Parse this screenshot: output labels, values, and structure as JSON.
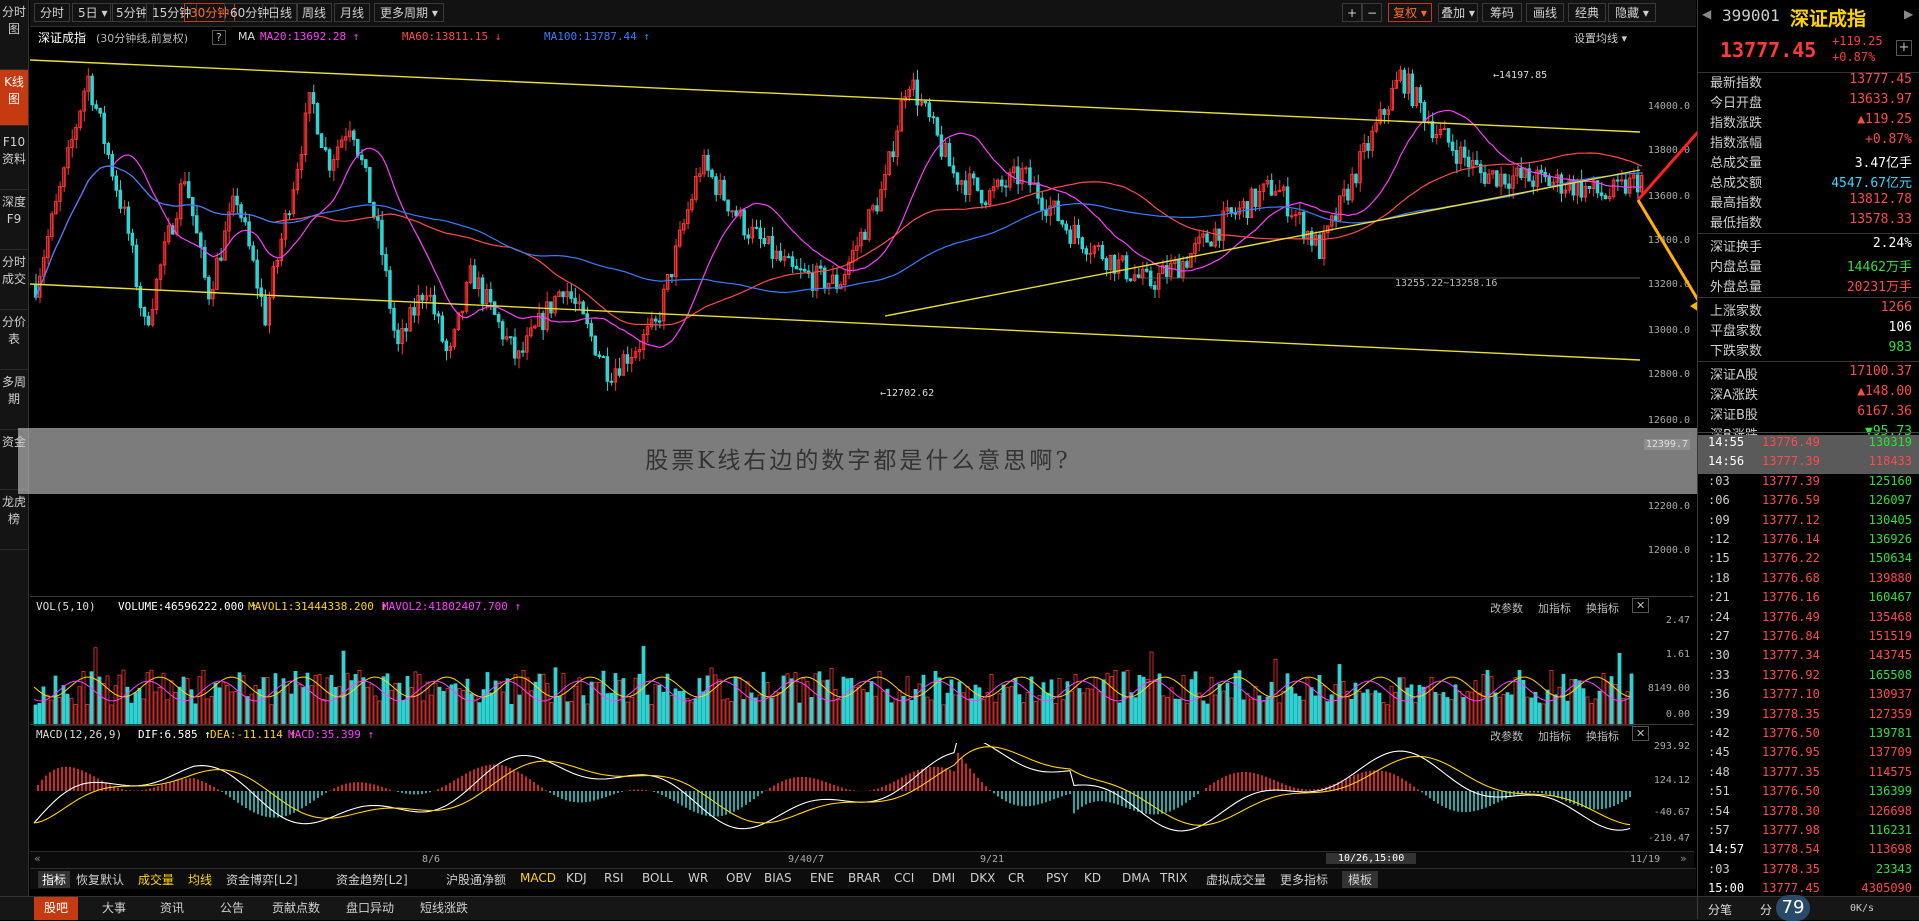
{
  "left_sidebar": [
    {
      "label": "分时图"
    },
    {
      "label": "K线图"
    },
    {
      "label": "F10资料"
    },
    {
      "label": "深度F9"
    },
    {
      "label": "分时成交"
    },
    {
      "label": "分价表"
    },
    {
      "label": "多周期"
    },
    {
      "label": "资金"
    },
    {
      "label": "龙虎榜"
    }
  ],
  "periods": [
    "分时",
    "5日 ▾",
    "5分钟",
    "15分钟",
    "30分钟",
    "60分钟",
    "日线",
    "周线",
    "月线",
    "更多周期 ▾"
  ],
  "toolbar_right": [
    "+",
    "−",
    "复权 ▾",
    "叠加 ▾",
    "筹码",
    "画线",
    "经典",
    "隐藏 ▾"
  ],
  "chart_legend": {
    "title": "深证成指",
    "subtitle": "(30分钟线,前复权)",
    "help": "?",
    "ma_label": "MA",
    "ma20": "MA20:13692.28 ↑",
    "ma60": "MA60:13811.15 ↓",
    "ma100": "MA100:13787.44 ↑",
    "settings": "设置均线 ▾"
  },
  "price_axis": [
    "14000.0",
    "13800.0",
    "13600.0",
    "13400.0",
    "13200.0",
    "13000.0",
    "12800.0",
    "12600.0",
    "12399.7",
    "12200.0",
    "12000.0"
  ],
  "annotations": {
    "high": "←14197.85",
    "low": "←12702.62",
    "range": "13255.22~13258.16"
  },
  "overlay_text": "股票K线右边的数字都是什么意思啊?",
  "vol_panel": {
    "label": "VOL(5,10)",
    "volume": "VOLUME:46596222.000 ↑",
    "mavol1": "MAVOL1:31444338.200 ↑",
    "mavol2": "MAVOL2:41802407.700 ↑",
    "axis": [
      "2.47",
      "1.61",
      "8149.00",
      "0.00"
    ],
    "actions": [
      "改参数",
      "加指标",
      "换指标"
    ]
  },
  "macd_panel": {
    "label": "MACD(12,26,9)",
    "dif": "DIF:6.585 ↑",
    "dea": "DEA:-11.114 ↑",
    "macd": "MACD:35.399 ↑",
    "axis": [
      "293.92",
      "124.12",
      "-40.67",
      "-210.47"
    ],
    "actions": [
      "改参数",
      "加指标",
      "换指标"
    ]
  },
  "x_axis": {
    "labels": [
      "8/6",
      "9/40/7",
      "9/21",
      "10/26,15:00",
      "11/19"
    ]
  },
  "indicator_tabs": [
    "指标",
    "恢复默认",
    "成交量",
    "均线",
    "资金博弈[L2]",
    "资金趋势[L2]",
    "沪股通净额",
    "MACD",
    "KDJ",
    "RSI",
    "BOLL",
    "WR",
    "OBV",
    "BIAS",
    "ENE",
    "BRAR",
    "CCI",
    "DMI",
    "DKX",
    "CR",
    "PSY",
    "KD",
    "DMA",
    "TRIX",
    "虚拟成交量",
    "更多指标",
    "模板"
  ],
  "status_tabs": [
    "股吧",
    "大事",
    "资讯",
    "公告",
    "贡献点数",
    "盘口异动",
    "短线涨跌"
  ],
  "quote": {
    "code": "399001",
    "name": "深证成指",
    "price": "13777.45",
    "change": "+119.25",
    "change_pct": "+0.87%",
    "plus": "+",
    "rows": [
      {
        "label": "最新指数",
        "value": "13777.45",
        "color": "red"
      },
      {
        "label": "今日开盘",
        "value": "13633.97",
        "color": "red"
      },
      {
        "label": "指数涨跌",
        "value": "▲119.25",
        "color": "red"
      },
      {
        "label": "指数涨幅",
        "value": "+0.87%",
        "color": "red"
      },
      {
        "label": "总成交量",
        "value": "3.47亿手",
        "color": "white"
      },
      {
        "label": "总成交额",
        "value": "4547.67亿元",
        "color": "cyan"
      },
      {
        "label": "最高指数",
        "value": "13812.78",
        "color": "red"
      },
      {
        "label": "最低指数",
        "value": "13578.33",
        "color": "red"
      },
      {
        "label": "深证换手",
        "value": "2.24%",
        "color": "white"
      },
      {
        "label": "内盘总量",
        "value": "14462万手",
        "color": "green"
      },
      {
        "label": "外盘总量",
        "value": "20231万手",
        "color": "red"
      },
      {
        "label": "上涨家数",
        "value": "1266",
        "color": "red"
      },
      {
        "label": "平盘家数",
        "value": "106",
        "color": "white"
      },
      {
        "label": "下跌家数",
        "value": "983",
        "color": "green"
      },
      {
        "label": "深证A股",
        "value": "17100.37",
        "color": "red"
      },
      {
        "label": "深A涨跌",
        "value": "▲148.00",
        "color": "red"
      },
      {
        "label": "深证B股",
        "value": "6167.36",
        "color": "red"
      },
      {
        "label": "深B涨跌",
        "value": "▼95.73",
        "color": "green"
      }
    ],
    "ticks": [
      {
        "time": "14:55",
        "price": "13776.49",
        "vol": "130319",
        "color": "green"
      },
      {
        "time": "14:56",
        "price": "13777.39",
        "vol": "118433",
        "color": "red"
      },
      {
        "time": ":03",
        "price": "13777.39",
        "vol": "125160",
        "color": "green"
      },
      {
        "time": ":06",
        "price": "13776.59",
        "vol": "126097",
        "color": "green"
      },
      {
        "time": ":09",
        "price": "13777.12",
        "vol": "130405",
        "color": "green"
      },
      {
        "time": ":12",
        "price": "13776.14",
        "vol": "136926",
        "color": "green"
      },
      {
        "time": ":15",
        "price": "13776.22",
        "vol": "150634",
        "color": "green"
      },
      {
        "time": ":18",
        "price": "13776.68",
        "vol": "139880",
        "color": "red"
      },
      {
        "time": ":21",
        "price": "13776.16",
        "vol": "160467",
        "color": "green"
      },
      {
        "time": ":24",
        "price": "13776.49",
        "vol": "135468",
        "color": "red"
      },
      {
        "time": ":27",
        "price": "13776.84",
        "vol": "151519",
        "color": "red"
      },
      {
        "time": ":30",
        "price": "13777.34",
        "vol": "143745",
        "color": "red"
      },
      {
        "time": ":33",
        "price": "13776.92",
        "vol": "165508",
        "color": "green"
      },
      {
        "time": ":36",
        "price": "13777.10",
        "vol": "130937",
        "color": "red"
      },
      {
        "time": ":39",
        "price": "13778.35",
        "vol": "127359",
        "color": "red"
      },
      {
        "time": ":42",
        "price": "13776.50",
        "vol": "139781",
        "color": "green"
      },
      {
        "time": ":45",
        "price": "13776.95",
        "vol": "137709",
        "color": "red"
      },
      {
        "time": ":48",
        "price": "13777.35",
        "vol": "114575",
        "color": "red"
      },
      {
        "time": ":51",
        "price": "13776.50",
        "vol": "136399",
        "color": "green"
      },
      {
        "time": ":54",
        "price": "13778.30",
        "vol": "126698",
        "color": "red"
      },
      {
        "time": ":57",
        "price": "13777.98",
        "vol": "116231",
        "color": "green"
      },
      {
        "time": "14:57",
        "price": "13778.54",
        "vol": "113698",
        "color": "red"
      },
      {
        "time": ":03",
        "price": "13778.35",
        "vol": "23343",
        "color": "green"
      },
      {
        "time": "15:00",
        "price": "13777.45",
        "vol": "4305090",
        "color": "red"
      }
    ],
    "bottom": {
      "tab1": "分笔",
      "tab2": "分",
      "gauge": "79",
      "speed": "0K/s"
    }
  }
}
